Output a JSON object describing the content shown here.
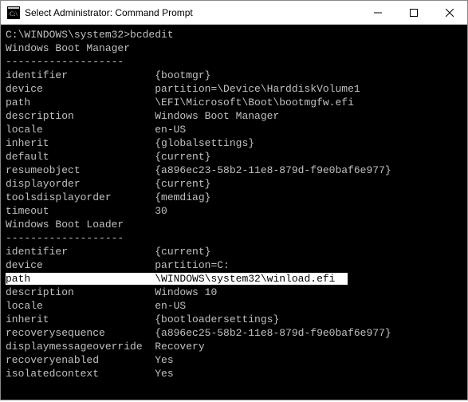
{
  "title": "Select Administrator: Command Prompt",
  "prompt_line": "C:\\WINDOWS\\system32>bcdedit",
  "section1_title": "Windows Boot Manager",
  "dashes": "-------------------",
  "bm": [
    {
      "k": "identifier",
      "v": "{bootmgr}"
    },
    {
      "k": "device",
      "v": "partition=\\Device\\HarddiskVolume1"
    },
    {
      "k": "path",
      "v": "\\EFI\\Microsoft\\Boot\\bootmgfw.efi"
    },
    {
      "k": "description",
      "v": "Windows Boot Manager"
    },
    {
      "k": "locale",
      "v": "en-US"
    },
    {
      "k": "inherit",
      "v": "{globalsettings}"
    },
    {
      "k": "default",
      "v": "{current}"
    },
    {
      "k": "resumeobject",
      "v": "{a896ec23-58b2-11e8-879d-f9e0baf6e977}"
    },
    {
      "k": "displayorder",
      "v": "{current}"
    },
    {
      "k": "toolsdisplayorder",
      "v": "{memdiag}"
    },
    {
      "k": "timeout",
      "v": "30"
    }
  ],
  "section2_title": "Windows Boot Loader",
  "bl": [
    {
      "k": "identifier",
      "v": "{current}"
    },
    {
      "k": "device",
      "v": "partition=C:"
    },
    {
      "k": "path",
      "v": "\\WINDOWS\\system32\\winload.efi"
    },
    {
      "k": "description",
      "v": "Windows 10"
    },
    {
      "k": "locale",
      "v": "en-US"
    },
    {
      "k": "inherit",
      "v": "{bootloadersettings}"
    },
    {
      "k": "recoverysequence",
      "v": "{a896ec25-58b2-11e8-879d-f9e0baf6e977}"
    },
    {
      "k": "displaymessageoverride",
      "v": "Recovery"
    },
    {
      "k": "recoveryenabled",
      "v": "Yes"
    },
    {
      "k": "isolatedcontext",
      "v": "Yes"
    }
  ],
  "highlighted_bl_index": 2
}
